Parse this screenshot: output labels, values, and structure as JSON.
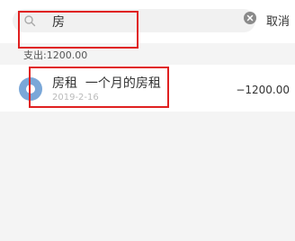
{
  "search": {
    "query": "房",
    "cancel_label": "取消"
  },
  "summary": {
    "expense_text": "支出:1200.00"
  },
  "results": [
    {
      "title": "房租  一个月的房租",
      "date": "2019-2-16",
      "amount": "−1200.00",
      "icon": "category-icon"
    }
  ],
  "colors": {
    "highlight": "#e02020",
    "avatar": "#7aa7d8"
  }
}
